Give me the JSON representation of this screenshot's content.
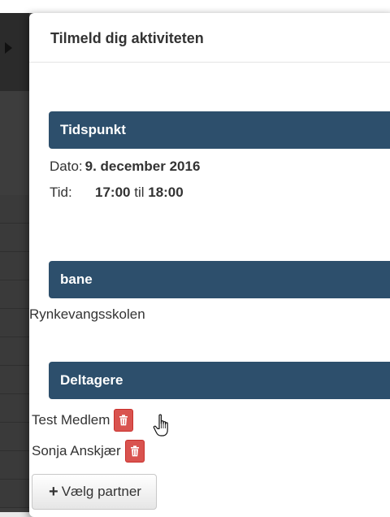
{
  "modal": {
    "title": "Tilmeld dig aktiviteten"
  },
  "sections": {
    "time": {
      "heading": "Tidspunkt",
      "date_label": "Dato:",
      "date_value": "9. december 2016",
      "time_label": "Tid:",
      "time_start": "17:00",
      "time_sep": "til",
      "time_end": "18:00"
    },
    "venue": {
      "heading": "bane",
      "value": "Rynkevangsskolen"
    },
    "participants": {
      "heading": "Deltagere",
      "items": [
        {
          "name": "Test Medlem"
        },
        {
          "name": "Sonja Anskjær"
        }
      ],
      "add_button_label": "Vælg partner",
      "add_icon": "plus-icon",
      "remove_icon": "trash-icon"
    }
  },
  "colors": {
    "section_bar": "#2d4f6c",
    "delete_button": "#d9534f"
  }
}
